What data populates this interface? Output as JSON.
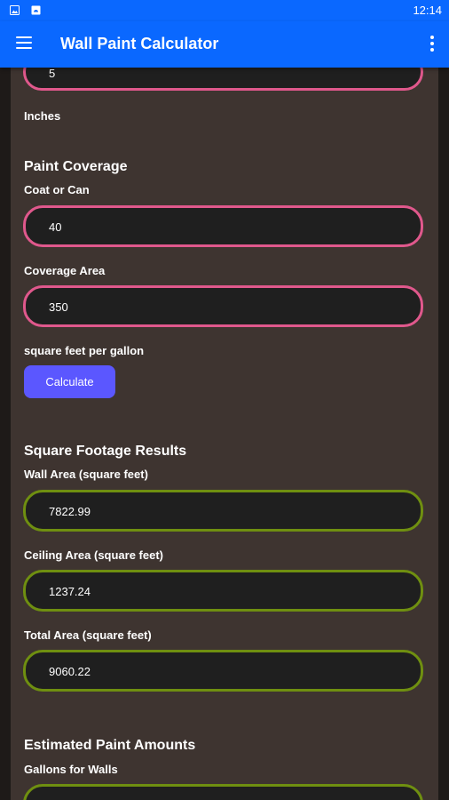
{
  "status": {
    "time": "12:14"
  },
  "appbar": {
    "title": "Wall Paint Calculator"
  },
  "depth": {
    "value": "5",
    "unit_label": "Inches"
  },
  "paint_coverage": {
    "heading": "Paint Coverage",
    "coat_label": "Coat or Can",
    "coat_value": "40",
    "coverage_label": "Coverage Area",
    "coverage_value": "350",
    "coverage_unit": "square feet per gallon",
    "calculate_label": "Calculate"
  },
  "results": {
    "heading": "Square Footage Results",
    "wall_label": "Wall Area (square feet)",
    "wall_value": "7822.99",
    "ceiling_label": "Ceiling Area (square feet)",
    "ceiling_value": "1237.24",
    "total_label": "Total Area (square feet)",
    "total_value": "9060.22"
  },
  "paint_amounts": {
    "heading": "Estimated Paint Amounts",
    "walls_label": "Gallons for Walls"
  },
  "colors": {
    "primary": "#0a68ff",
    "input_border": "#e0588c",
    "result_border": "#6f8f10",
    "button": "#5b57ff",
    "content_bg": "#3e3430"
  }
}
